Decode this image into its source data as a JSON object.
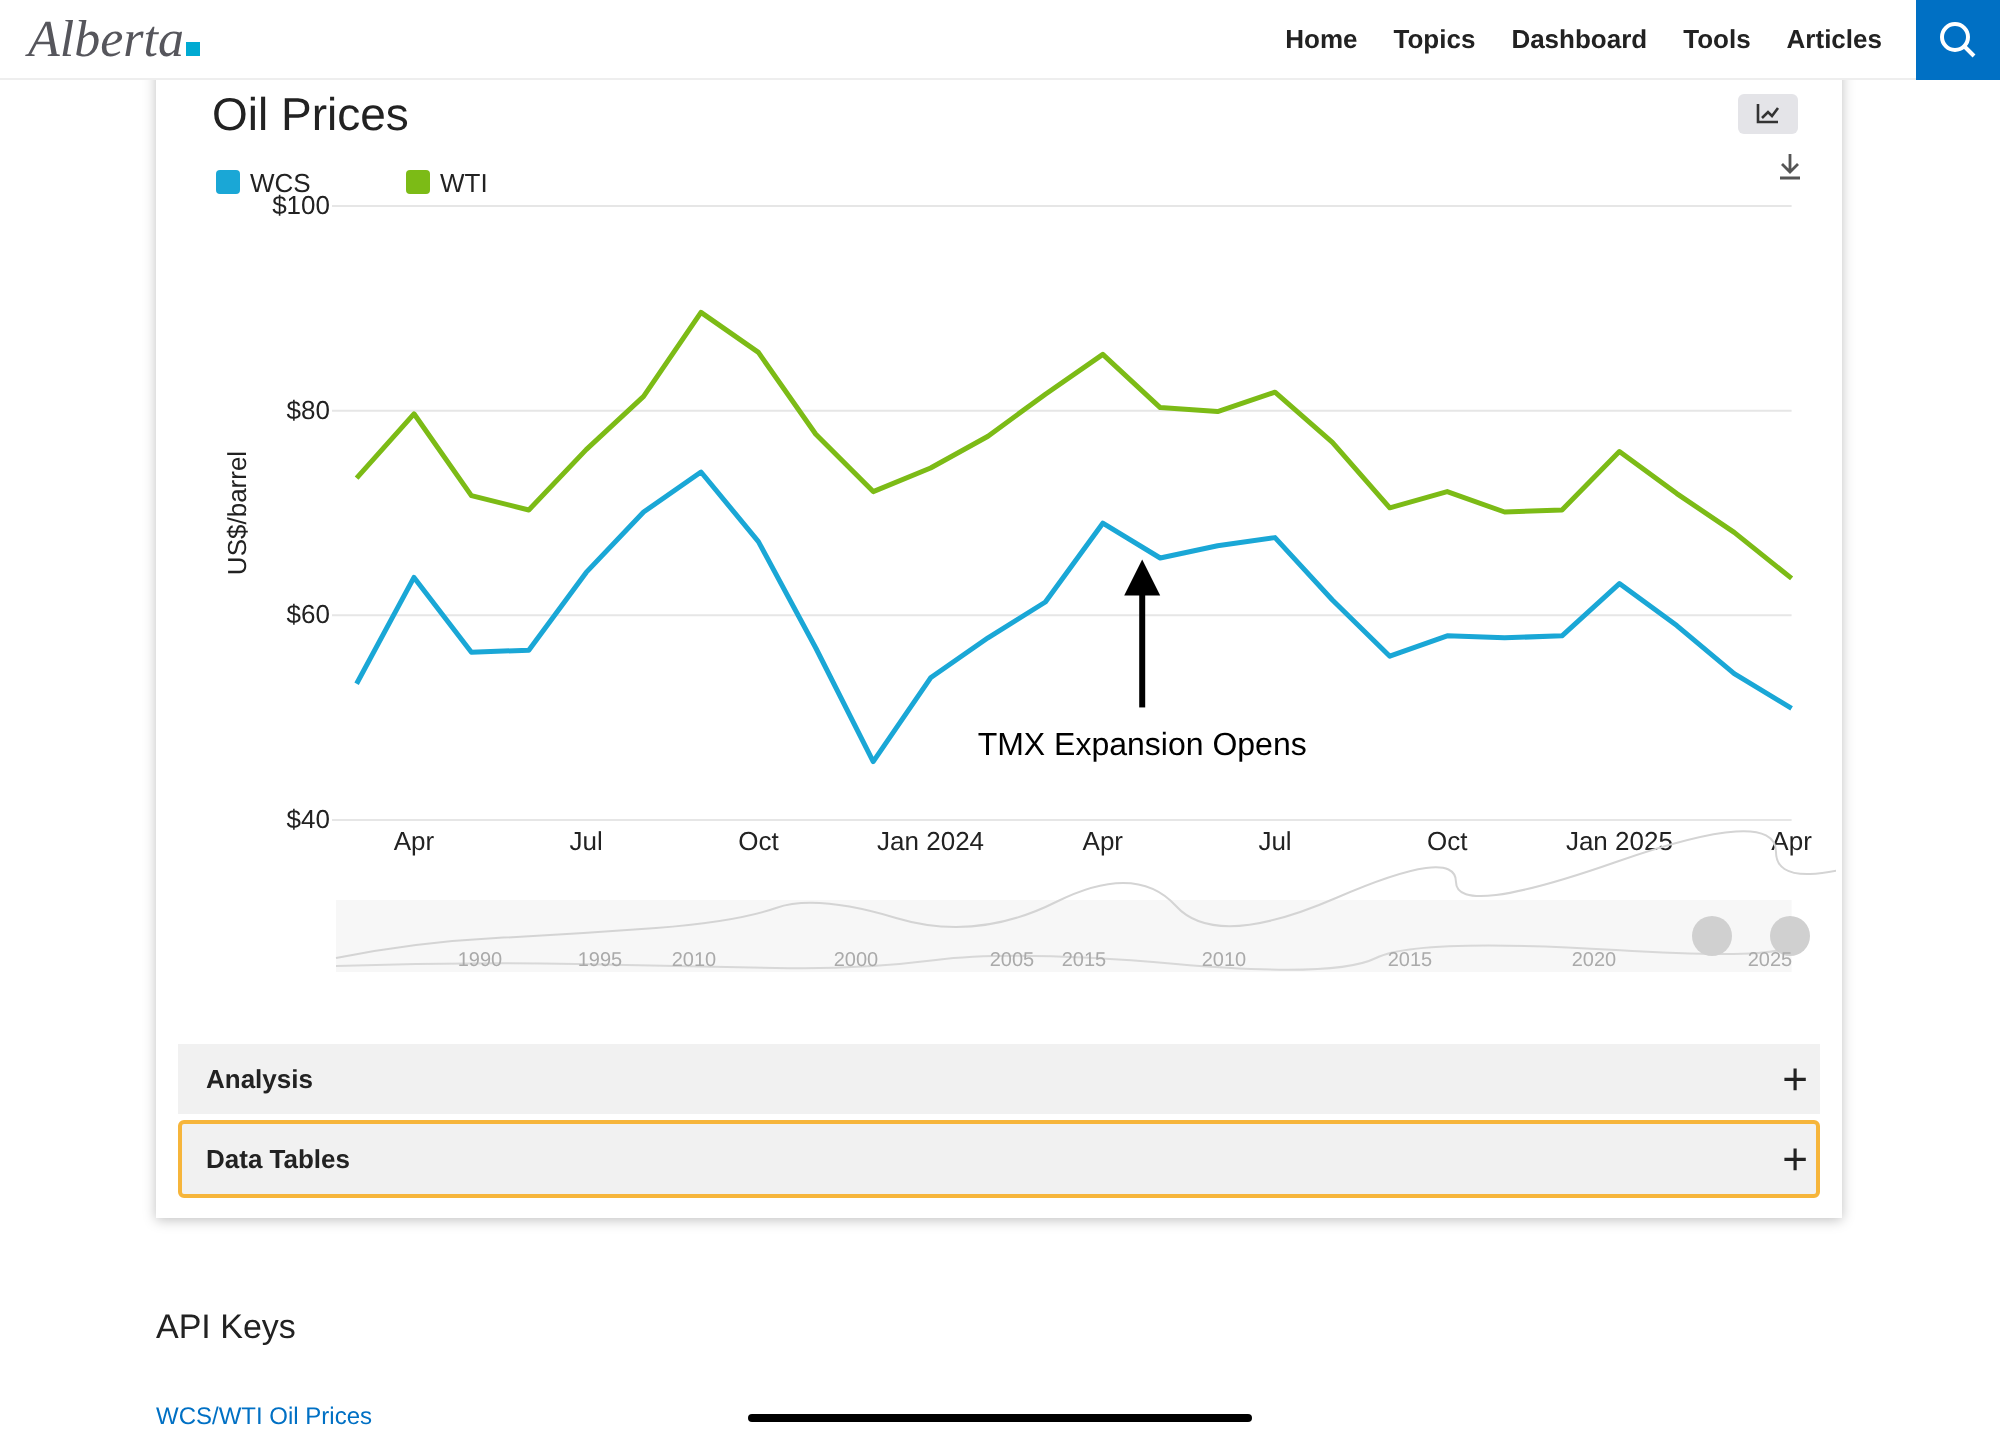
{
  "header": {
    "logo": "Alberta",
    "nav": [
      "Home",
      "Topics",
      "Dashboard",
      "Tools",
      "Articles"
    ]
  },
  "card": {
    "title": "Oil Prices",
    "chart_data": {
      "type": "line",
      "ylabel": "US$/barrel",
      "ylim": [
        40,
        100
      ],
      "legend": "top-left",
      "yticks": [
        {
          "value": 40,
          "label": "$40"
        },
        {
          "value": 60,
          "label": "$60"
        },
        {
          "value": 80,
          "label": "$80"
        },
        {
          "value": 100,
          "label": "$100"
        }
      ],
      "categories": [
        null,
        "Apr",
        null,
        null,
        "Jul",
        null,
        null,
        "Oct",
        null,
        null,
        "Jan 2024",
        null,
        null,
        "Apr",
        null,
        null,
        "Jul",
        null,
        null,
        "Oct",
        null,
        null,
        "Jan 2025",
        null,
        null,
        "Apr"
      ],
      "series": [
        {
          "name": "WCS",
          "color": "#1aa7d6",
          "values": [
            53.3,
            63.7,
            56.4,
            56.6,
            64.2,
            70.1,
            74.0,
            67.2,
            56.8,
            45.7,
            53.9,
            57.8,
            61.3,
            69.0,
            65.6,
            66.8,
            67.6,
            61.5,
            56.0,
            58.0,
            57.8,
            58.0,
            63.1,
            59.0,
            54.3,
            50.9
          ]
        },
        {
          "name": "WTI",
          "color": "#7cbb16",
          "values": [
            73.4,
            79.7,
            71.7,
            70.3,
            76.2,
            81.4,
            89.6,
            85.7,
            77.7,
            72.1,
            74.4,
            77.5,
            81.6,
            85.5,
            80.3,
            79.9,
            81.8,
            76.9,
            70.5,
            72.1,
            70.1,
            70.3,
            76.0,
            71.9,
            68.1,
            63.6
          ]
        }
      ],
      "annotations": [
        "TMX Expansion Opens"
      ]
    },
    "navigator_labels": [
      "1990",
      "1995",
      "2010",
      "2000",
      "2005",
      "2015",
      "2010",
      "2015",
      "2020",
      "2025"
    ],
    "sections": [
      {
        "label": "Analysis",
        "highlighted": false,
        "symbol": "+"
      },
      {
        "label": "Data Tables",
        "highlighted": true,
        "symbol": "+"
      }
    ]
  },
  "api": {
    "heading": "API Keys",
    "link": "WCS/WTI Oil Prices"
  }
}
